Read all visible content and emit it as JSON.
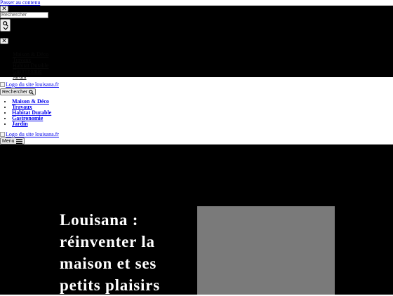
{
  "skip_link": "Passer au contenu",
  "search_overlay": {
    "close_symbol": "✕",
    "search": {
      "placeholder": "Rechercher"
    },
    "submit": {
      "icon": "search-icon",
      "chevron": "chevron-down-icon"
    },
    "close2_symbol": "✕",
    "menu_items": [
      "Maison & Déco",
      "Travaux",
      "Habitat Durable",
      "Gastronomie",
      "Jardin"
    ]
  },
  "header": {
    "logo_alt": "Logo du site louisana.fr",
    "search_button": "Rechercher",
    "nav": [
      "Maison & Déco",
      "Travaux",
      "Habitat Durable",
      "Gastronomie",
      "Jardin"
    ],
    "logo_alt_2": "Logo du site louisana.fr",
    "menu_button": "Menu"
  },
  "hero": {
    "title": "Louisana : réinventer la maison et ses petits plaisirs"
  },
  "colors": {
    "overlay_bg": "#000000",
    "hero_bg": "#000000",
    "hero_text": "#ffffff",
    "image_placeholder": "#7a7a7a"
  }
}
